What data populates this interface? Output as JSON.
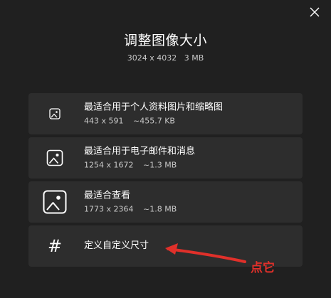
{
  "dialog": {
    "title": "调整图像大小",
    "original_dimensions": "3024 x 4032",
    "original_size": "3 MB"
  },
  "options": [
    {
      "label": "最适合用于个人资料图片和缩略图",
      "dimensions": "443 x 591",
      "size": "~455.7 KB",
      "icon": "image-small-icon"
    },
    {
      "label": "最适合用于电子邮件和消息",
      "dimensions": "1254 x 1672",
      "size": "~1.3 MB",
      "icon": "image-medium-icon"
    },
    {
      "label": "最适合查看",
      "dimensions": "1773 x 2364",
      "size": "~1.8 MB",
      "icon": "image-large-icon"
    },
    {
      "label": "定义自定义尺寸",
      "icon": "hash-icon",
      "icon_glyph": "#"
    }
  ],
  "annotation": {
    "text": "点它",
    "color": "#e0302a"
  },
  "colors": {
    "background": "#202020",
    "card": "#2d2d2d"
  }
}
